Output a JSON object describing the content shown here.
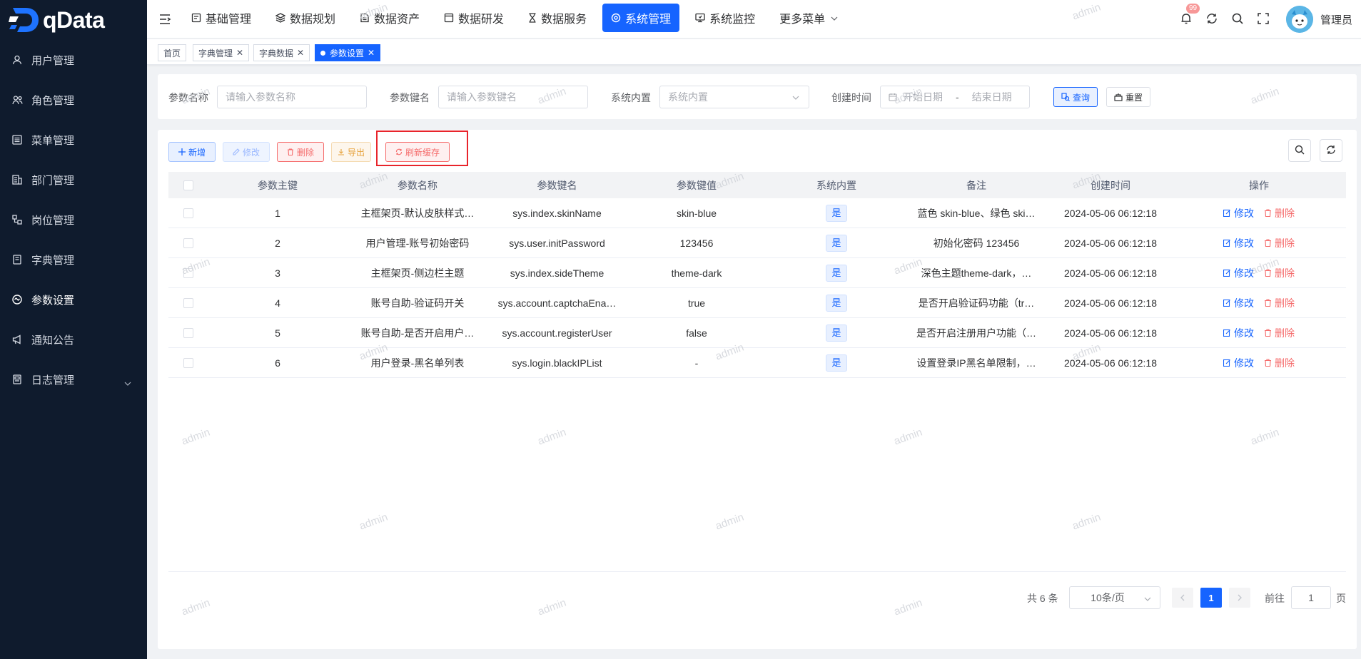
{
  "brand": {
    "name": "qData"
  },
  "sidebar": {
    "items": [
      {
        "label": "用户管理",
        "icon": "user-icon"
      },
      {
        "label": "角色管理",
        "icon": "users-icon"
      },
      {
        "label": "菜单管理",
        "icon": "menu-list-icon"
      },
      {
        "label": "部门管理",
        "icon": "department-icon"
      },
      {
        "label": "岗位管理",
        "icon": "post-icon"
      },
      {
        "label": "字典管理",
        "icon": "dictionary-icon"
      },
      {
        "label": "参数设置",
        "icon": "settings-circle-icon",
        "active": true
      },
      {
        "label": "通知公告",
        "icon": "megaphone-icon"
      },
      {
        "label": "日志管理",
        "icon": "log-icon",
        "expandable": true
      }
    ]
  },
  "topnav": {
    "items": [
      {
        "label": "基础管理",
        "icon": "base-icon"
      },
      {
        "label": "数据规划",
        "icon": "layers-icon"
      },
      {
        "label": "数据资产",
        "icon": "asset-icon"
      },
      {
        "label": "数据研发",
        "icon": "dev-icon"
      },
      {
        "label": "数据服务",
        "icon": "hourglass-icon"
      },
      {
        "label": "系统管理",
        "icon": "system-icon",
        "active": true
      },
      {
        "label": "系统监控",
        "icon": "monitor-icon"
      },
      {
        "label": "更多菜单",
        "icon": ""
      }
    ],
    "notification_count": "99",
    "user_name": "管理员"
  },
  "tags": [
    {
      "label": "首页"
    },
    {
      "label": "字典管理",
      "closable": true
    },
    {
      "label": "字典数据",
      "closable": true
    },
    {
      "label": "参数设置",
      "closable": true,
      "active": true
    }
  ],
  "search": {
    "config_name_label": "参数名称",
    "config_name_placeholder": "请输入参数名称",
    "config_key_label": "参数键名",
    "config_key_placeholder": "请输入参数键名",
    "builtin_label": "系统内置",
    "builtin_placeholder": "系统内置",
    "created_label": "创建时间",
    "start_placeholder": "开始日期",
    "date_sep": "-",
    "end_placeholder": "结束日期",
    "query_label": "查询",
    "reset_label": "重置"
  },
  "toolbar": {
    "add_label": "新增",
    "edit_label": "修改",
    "delete_label": "删除",
    "export_label": "导出",
    "refresh_cache_label": "刷新缓存"
  },
  "table": {
    "columns": [
      "参数主键",
      "参数名称",
      "参数键名",
      "参数键值",
      "系统内置",
      "备注",
      "创建时间",
      "操作"
    ],
    "rows": [
      {
        "id": "1",
        "name": "主框架页-默认皮肤样式…",
        "key": "sys.index.skinName",
        "value": "skin-blue",
        "builtin": "是",
        "remark": "蓝色 skin-blue、绿色 ski…",
        "created": "2024-05-06 06:12:18"
      },
      {
        "id": "2",
        "name": "用户管理-账号初始密码",
        "key": "sys.user.initPassword",
        "value": "123456",
        "builtin": "是",
        "remark": "初始化密码 123456",
        "created": "2024-05-06 06:12:18"
      },
      {
        "id": "3",
        "name": "主框架页-侧边栏主题",
        "key": "sys.index.sideTheme",
        "value": "theme-dark",
        "builtin": "是",
        "remark": "深色主题theme-dark，…",
        "created": "2024-05-06 06:12:18"
      },
      {
        "id": "4",
        "name": "账号自助-验证码开关",
        "key": "sys.account.captchaEna…",
        "value": "true",
        "builtin": "是",
        "remark": "是否开启验证码功能（tr…",
        "created": "2024-05-06 06:12:18"
      },
      {
        "id": "5",
        "name": "账号自助-是否开启用户…",
        "key": "sys.account.registerUser",
        "value": "false",
        "builtin": "是",
        "remark": "是否开启注册用户功能（…",
        "created": "2024-05-06 06:12:18"
      },
      {
        "id": "6",
        "name": "用户登录-黑名单列表",
        "key": "sys.login.blackIPList",
        "value": "-",
        "builtin": "是",
        "remark": "设置登录IP黑名单限制，…",
        "created": "2024-05-06 06:12:18"
      }
    ],
    "edit_label": "修改",
    "delete_label": "删除"
  },
  "pagination": {
    "total_text": "共 6 条",
    "page_size": "10条/页",
    "current_page": "1",
    "goto_label": "前往",
    "goto_value": "1",
    "page_suffix": "页"
  },
  "watermark": "admin",
  "colors": {
    "primary": "#1664ff",
    "danger": "#f56c6c",
    "warning": "#e6a23c",
    "sidebar": "#0f1b2d",
    "highlight": "#e8242b"
  }
}
